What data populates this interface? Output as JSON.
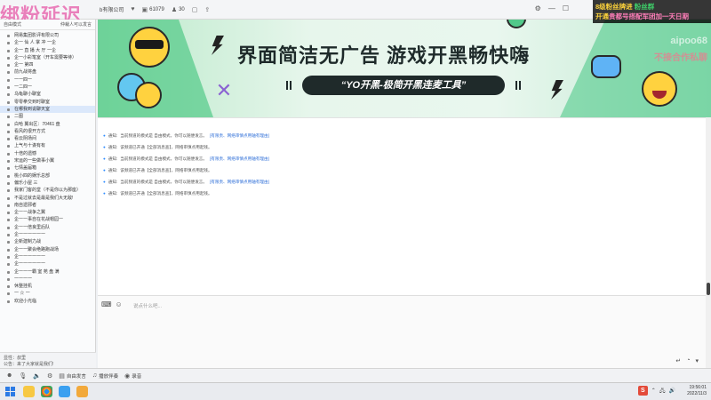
{
  "stream_overlay": {
    "title": "绑粉延迟",
    "line1": "8级粉丝牌进",
    "line1b": "粉丝群",
    "line2": "开通",
    "line2b": "贵都号搭配军团加一天日期",
    "watermark": "aipoo68",
    "watermark2": "不接合作私聊"
  },
  "titlebar": {
    "company": "b有限公司",
    "likes": "61079",
    "members": "30"
  },
  "sidebar": {
    "header_left": "自由模式",
    "header_right": "仲裁人可以发言",
    "items": [
      {
        "label": "网易集团影评有限公司",
        "active": false
      },
      {
        "label": "企一 仙 人 掌 冲 一企",
        "active": false
      },
      {
        "label": "企一 直 播 大 厅 一企",
        "active": false
      },
      {
        "label": "企一小彩笔室（开车需要等待）",
        "active": false
      },
      {
        "label": "企一 第四",
        "active": false
      },
      {
        "label": "前九战将盘",
        "active": false
      },
      {
        "label": "一一四一",
        "active": false
      },
      {
        "label": "一二四一",
        "active": false
      },
      {
        "label": "乌龟聊小聊室",
        "active": false
      },
      {
        "label": "零零拳交到时聊室",
        "active": false
      },
      {
        "label": "在哪我到说聊天室",
        "active": true
      },
      {
        "label": "二图",
        "active": false
      },
      {
        "label": "白哈 翼出区：70461 盘",
        "active": false
      },
      {
        "label": "看风的很开方式",
        "active": false
      },
      {
        "label": "看云阴场间",
        "active": false
      },
      {
        "label": "上气与十诶有有",
        "active": false
      },
      {
        "label": "十倍的遗憾",
        "active": false
      },
      {
        "label": "宋运的一些做事小翼",
        "active": false
      },
      {
        "label": "七情盖届箱",
        "active": false
      },
      {
        "label": "桃小四的娱乐总部",
        "active": false
      },
      {
        "label": "偏乐小屋 三",
        "active": false
      },
      {
        "label": "我家门客的堂（不是你以为那座）",
        "active": false
      },
      {
        "label": "不是过就去是最是我们大无敌!",
        "active": false
      },
      {
        "label": "南自遗邪者",
        "active": false
      },
      {
        "label": "企一一战争之翼",
        "active": false
      },
      {
        "label": "企一一事自在花战帽园一",
        "active": false
      },
      {
        "label": "企一一倍良里后队",
        "active": false
      },
      {
        "label": "企一一一一一一",
        "active": false
      },
      {
        "label": "企新建制力战",
        "active": false
      },
      {
        "label": "企一一聚会绝路跑战场",
        "active": false
      },
      {
        "label": "企一一一一一一",
        "active": false
      },
      {
        "label": "企一一一一一一",
        "active": false
      },
      {
        "label": "企一一一霸 室 苑 盘 满",
        "active": false
      },
      {
        "label": "一一一一",
        "active": false
      },
      {
        "label": "休整挂机",
        "active": false
      },
      {
        "label": "一 ☆ 一",
        "active": false
      },
      {
        "label": "欢迎小光临",
        "active": false
      }
    ],
    "footer_line1": "显性：叔里",
    "footer_line2": "公告：来了大家就是我们!"
  },
  "banner": {
    "headline": "界面简洁无广告  游戏开黑畅快嗨",
    "slogan": "“YO开黑-极简开黑连麦工具”"
  },
  "chat": {
    "messages": [
      {
        "prefix": "通知:",
        "text": "当前频道的模式是 自由模式，你可以随便发言。",
        "tail": "[有限责、网络审慎点用轴有理由]"
      },
      {
        "prefix": "通知:",
        "text": "该频道已开通【全部消息查】，网络审慎点用起钱。",
        "tail": ""
      },
      {
        "prefix": "通知:",
        "text": "当前频道的模式是 自由模式，你可以随便发言。",
        "tail": "[有限责、网络审慎点用轴有理由]"
      },
      {
        "prefix": "通知:",
        "text": "该频道已开通【全部消息查】，网络审慎点用起钱。",
        "tail": ""
      },
      {
        "prefix": "通知:",
        "text": "当前频道的模式是 自由模式，你可以随便发言。",
        "tail": "[有限责、网络审慎点用轴有理由]"
      },
      {
        "prefix": "通知:",
        "text": "该频道已开通【全部消息查】，网络审慎点用起钱。",
        "tail": ""
      }
    ]
  },
  "input": {
    "placeholder": "说点什么吧..."
  },
  "bottombar": {
    "items": [
      "自由发言",
      "播放伴奏",
      "录音"
    ]
  },
  "taskbar": {
    "time": "19:56:01",
    "date": "2022/11/3"
  }
}
